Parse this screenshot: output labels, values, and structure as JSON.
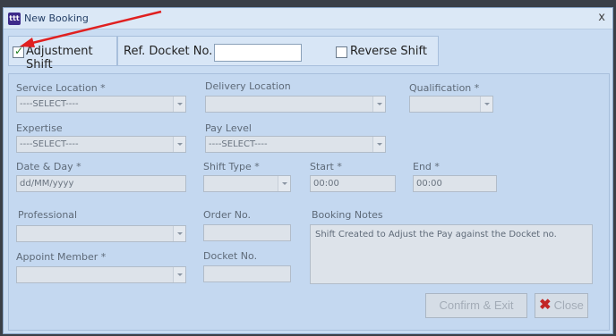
{
  "window": {
    "title": "New Booking",
    "app_icon_text": "ttt",
    "close_glyph": "x"
  },
  "top_bar": {
    "adjustment_shift_label": "Adjustment Shift",
    "adjustment_shift_checked": true,
    "ref_docket_label": "Ref. Docket No.",
    "ref_docket_value": "",
    "reverse_shift_label": "Reverse Shift",
    "reverse_shift_checked": false
  },
  "form": {
    "service_location_label": "Service Location *",
    "service_location_value": "----SELECT----",
    "delivery_location_label": "Delivery Location",
    "delivery_location_value": "",
    "qualification_label": "Qualification *",
    "qualification_value": "",
    "expertise_label": "Expertise",
    "expertise_value": "----SELECT----",
    "pay_level_label": "Pay Level",
    "pay_level_value": "----SELECT----",
    "date_day_label": "Date & Day *",
    "date_day_value": "dd/MM/yyyy",
    "shift_type_label": "Shift Type *",
    "shift_type_value": "",
    "start_label": "Start *",
    "start_value": "00:00",
    "end_label": "End *",
    "end_value": "00:00",
    "professional_label": "Professional",
    "professional_value": "",
    "order_no_label": "Order No.",
    "order_no_value": "",
    "booking_notes_label": "Booking Notes",
    "booking_notes_value": "Shift Created to Adjust the Pay against the Docket no.",
    "appoint_member_label": "Appoint Member *",
    "appoint_member_value": "",
    "docket_no_label": "Docket No.",
    "docket_no_value": ""
  },
  "buttons": {
    "confirm_exit": "Confirm & Exit",
    "close": "Close"
  },
  "colors": {
    "window_bg": "#c9dcf2",
    "annotation_arrow": "#e02020",
    "close_icon": "#c22525",
    "check_mark": "#1c7d1c"
  }
}
